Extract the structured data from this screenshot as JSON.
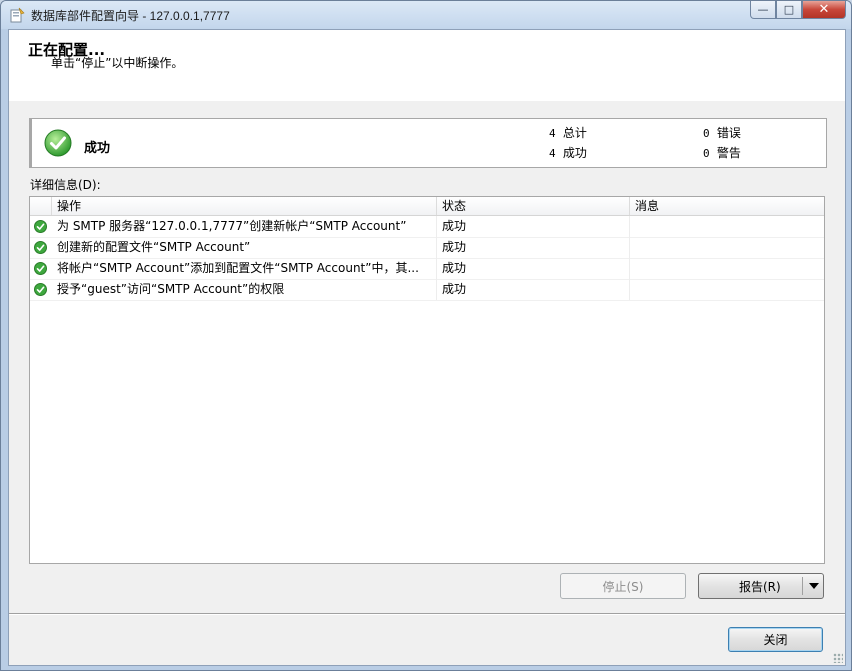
{
  "window": {
    "title": "数据库部件配置向导 - 127.0.0.1,7777",
    "controls": {
      "minimize": "—",
      "maximize": "□",
      "close": "✕"
    }
  },
  "header": {
    "title": "正在配置...",
    "subtitle": "单击“停止”以中断操作。"
  },
  "summary": {
    "status": "成功",
    "total_count": "4",
    "total_label": "总计",
    "success_count": "4",
    "success_label": "成功",
    "error_count": "0",
    "error_label": "错误",
    "warning_count": "0",
    "warning_label": "警告",
    "status_color": "#3aa23a"
  },
  "details": {
    "label": "详细信息(D):",
    "columns": [
      "操作",
      "状态",
      "消息"
    ],
    "rows": [
      {
        "action": "为 SMTP 服务器“127.0.0.1,7777”创建新帐户“SMTP Account”",
        "status": "成功",
        "message": ""
      },
      {
        "action": "创建新的配置文件“SMTP Account”",
        "status": "成功",
        "message": ""
      },
      {
        "action": "将帐户“SMTP Account”添加到配置文件“SMTP Account”中，其...",
        "status": "成功",
        "message": ""
      },
      {
        "action": "授予“guest”访问“SMTP Account”的权限",
        "status": "成功",
        "message": ""
      }
    ]
  },
  "buttons": {
    "stop": "停止(S)",
    "report": "报告(R)",
    "close": "关闭"
  }
}
